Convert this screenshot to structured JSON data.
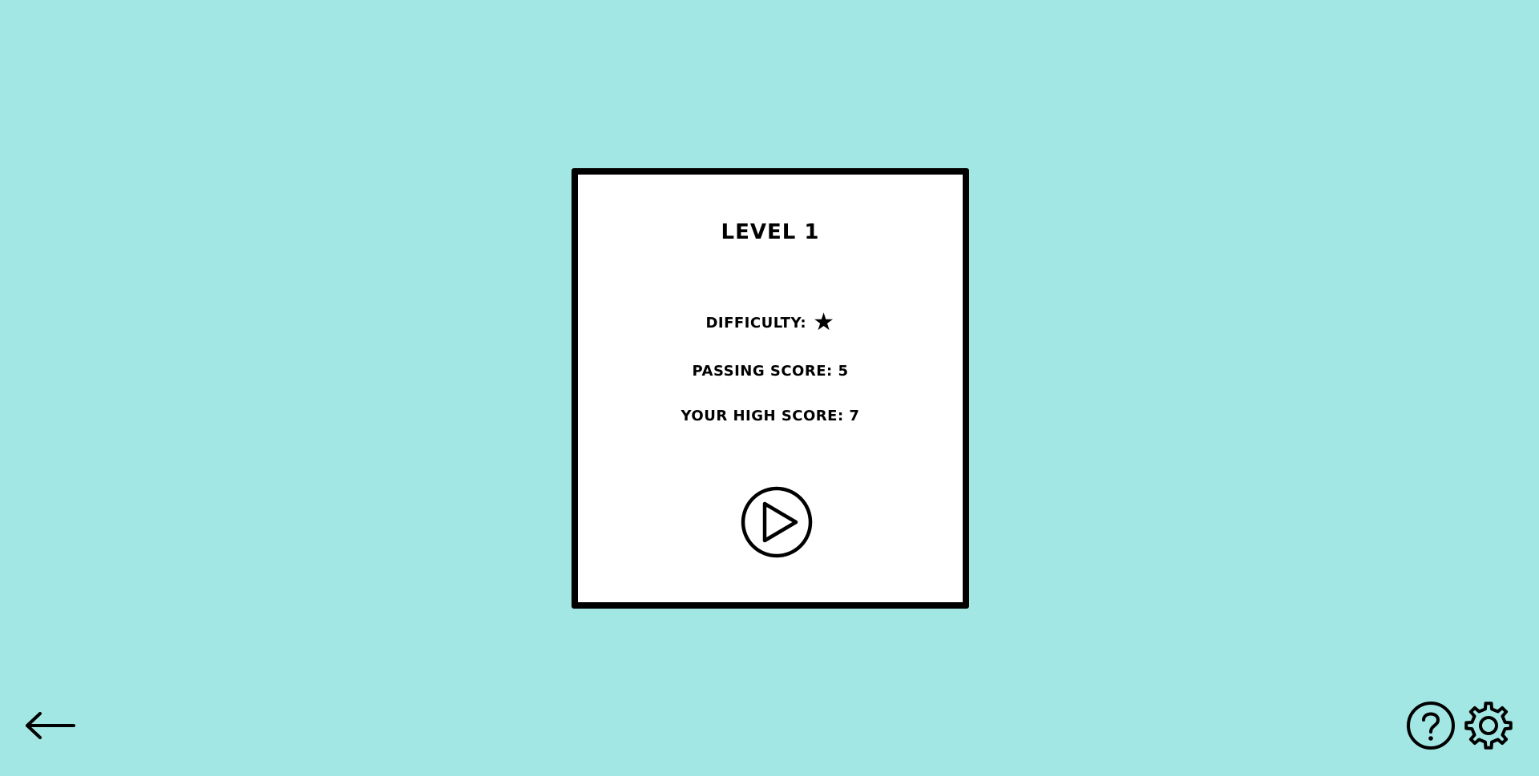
{
  "level": {
    "title": "LEVEL 1",
    "difficulty_label": "DIFFICULTY:",
    "difficulty_stars": 1,
    "difficulty_star_glyph": "★",
    "passing_score_text": "PASSING SCORE: 5",
    "high_score_text": "YOUR HIGH SCORE: 7"
  },
  "controls": {
    "play_icon": "play-icon",
    "back_icon": "arrow-left-icon",
    "help_icon": "help-icon",
    "settings_icon": "gear-icon"
  },
  "colors": {
    "background": "#a3e7e4",
    "card": "#ffffff",
    "ink": "#000000"
  }
}
